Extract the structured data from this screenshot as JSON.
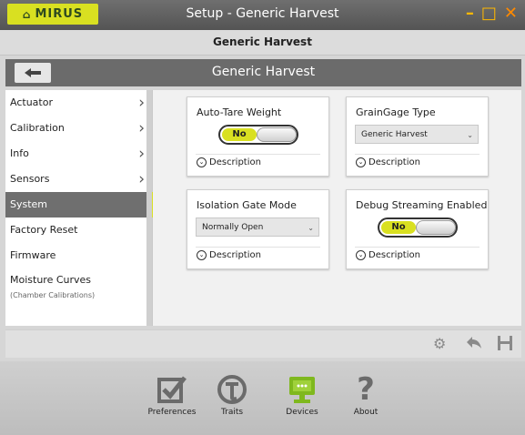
{
  "app": {
    "logo_text": "MIRUS",
    "window_title": "Setup - Generic Harvest",
    "subtitle": "Generic Harvest"
  },
  "nav": {
    "title": "Generic Harvest",
    "back_icon": "arrow-left-icon"
  },
  "sidebar": {
    "items": [
      {
        "label": "Actuator",
        "chevron": true
      },
      {
        "label": "Calibration",
        "chevron": true
      },
      {
        "label": "Info",
        "chevron": true
      },
      {
        "label": "Sensors",
        "chevron": true
      },
      {
        "label": "System",
        "active": true
      },
      {
        "label": "Factory Reset"
      },
      {
        "label": "Firmware"
      },
      {
        "label": "Moisture Curves",
        "sublabel": "(Chamber Calibrations)"
      }
    ]
  },
  "cards": {
    "auto_tare": {
      "title": "Auto-Tare Weight",
      "toggle": "No",
      "description": "Description"
    },
    "graingage": {
      "title": "GrainGage Type",
      "selected": "Generic Harvest",
      "description": "Description"
    },
    "isolation": {
      "title": "Isolation Gate Mode",
      "selected": "Normally Open",
      "description": "Description"
    },
    "debug": {
      "title": "Debug Streaming Enabled",
      "toggle": "No",
      "description": "Description"
    }
  },
  "bottom_tabs": [
    {
      "label": "Preferences",
      "icon": "checkbox-icon"
    },
    {
      "label": "Traits",
      "icon": "traits-icon"
    },
    {
      "label": "Devices",
      "icon": "monitor-icon",
      "active": true
    },
    {
      "label": "About",
      "icon": "question-icon"
    }
  ],
  "colors": {
    "accent": "#d9e021",
    "devices_icon": "#7fb81e"
  }
}
